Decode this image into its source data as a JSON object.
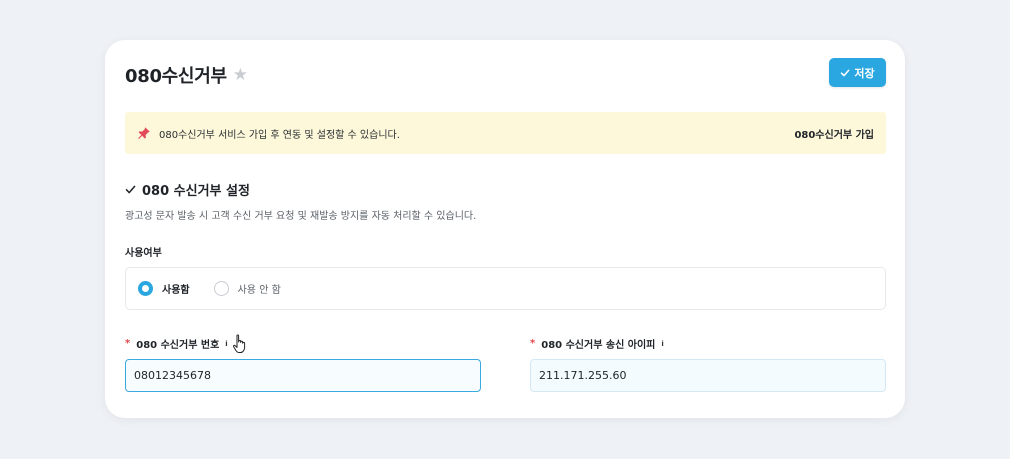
{
  "header": {
    "title": "080수신거부",
    "save_label": "저장"
  },
  "notice": {
    "text": "080수신거부 서비스 가입 후 연동 및 설정할 수 있습니다.",
    "link_label": "080수신거부 가입"
  },
  "section": {
    "title": "080 수신거부 설정",
    "description": "광고성 문자 발송 시 고객 수신 거부 요청 및 재발송 방지를 자동 처리할 수 있습니다."
  },
  "usage": {
    "label": "사용여부",
    "options": [
      {
        "label": "사용함",
        "selected": true
      },
      {
        "label": "사용 안 함",
        "selected": false
      }
    ]
  },
  "fields": {
    "number": {
      "label": "080 수신거부 번호",
      "required_mark": "*",
      "info": "i",
      "value": "08012345678"
    },
    "ip": {
      "label": "080 수신거부 송신 아이피",
      "required_mark": "*",
      "info": "i",
      "value": "211.171.255.60"
    }
  },
  "colors": {
    "accent": "#2aa7e0",
    "notice_bg": "#fdf8d9",
    "required": "#e5484d"
  }
}
